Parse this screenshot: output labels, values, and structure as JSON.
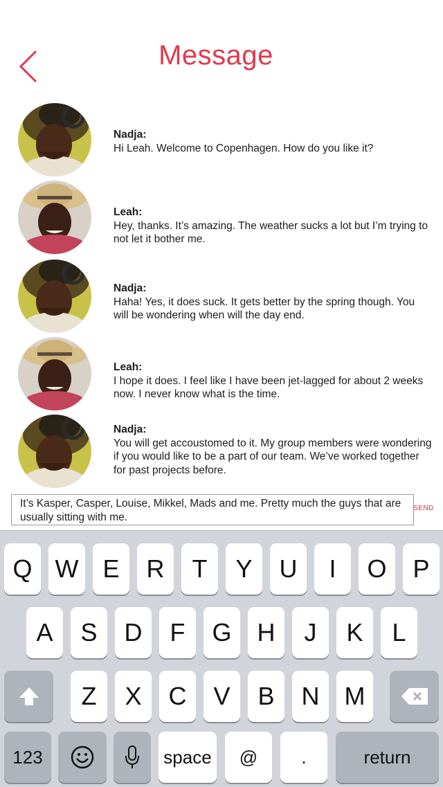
{
  "header": {
    "title": "Message",
    "back_icon": "chevron-left-icon"
  },
  "colors": {
    "accent": "#e2384d",
    "keyboard_bg": "#d1d5db",
    "key_dark": "#aeb3bc"
  },
  "messages": [
    {
      "sender": "Nadja:",
      "text": "Hi Leah. Welcome to Copenhagen. How do you like it?"
    },
    {
      "sender": "Leah:",
      "text": "Hey, thanks. It’s amazing. The weather sucks a lot but I’m trying to not let it bother me."
    },
    {
      "sender": "Nadja:",
      "text": "Haha! Yes, it does suck. It gets better by the spring though. You will be wondering when will the day end."
    },
    {
      "sender": "Leah:",
      "text": "I hope it does. I feel like I have been jet-lagged for about 2 weeks now. I never know what is the time."
    },
    {
      "sender": "Nadja:",
      "text": "You will get accoustomed to it. My group members were wondering if you would like to be a part of our team. We’ve worked together for past projects before."
    }
  ],
  "composer": {
    "value": "It’s Kasper, Casper, Louise, Mikkel, Mads and me. Pretty much the guys that are usually sitting with me.",
    "send_label": "SEND"
  },
  "keyboard": {
    "row1": [
      "Q",
      "W",
      "E",
      "R",
      "T",
      "Y",
      "U",
      "I",
      "O",
      "P"
    ],
    "row2": [
      "A",
      "S",
      "D",
      "F",
      "G",
      "H",
      "J",
      "K",
      "L"
    ],
    "row3": [
      "Z",
      "X",
      "C",
      "V",
      "B",
      "N",
      "M"
    ],
    "numbers_label": "123",
    "space_label": "space",
    "at_label": "@",
    "period_label": ".",
    "return_label": "return"
  }
}
